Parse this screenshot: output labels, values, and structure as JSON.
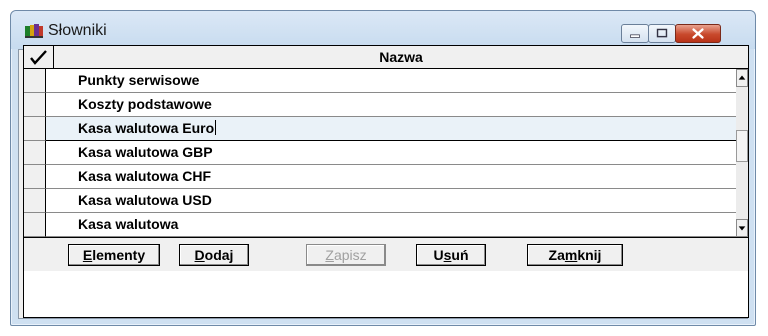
{
  "window": {
    "title": "Słowniki"
  },
  "grid": {
    "header_check_icon": "checkmark-icon",
    "column_name": "Nazwa",
    "rows": [
      "Punkty serwisowe",
      "Koszty podstawowe",
      "Kasa walutowa Euro",
      "Kasa walutowa GBP",
      "Kasa walutowa CHF",
      "Kasa walutowa USD",
      "Kasa walutowa"
    ],
    "current_row": 2
  },
  "buttons": {
    "elementy": {
      "first": "E",
      "rest": "lementy"
    },
    "dodaj": {
      "first": "D",
      "rest": "odaj"
    },
    "zapisz": {
      "first": "Z",
      "rest": "apisz"
    },
    "usun": {
      "first": "U",
      "second": "s",
      "rest": "uń"
    },
    "zamknij": {
      "first": "Za",
      "second": "m",
      "rest": "knij"
    }
  },
  "colors": {
    "titlebar": "#c7dbef",
    "close_button": "#c8492c",
    "current_row": "#eaf2f8"
  }
}
